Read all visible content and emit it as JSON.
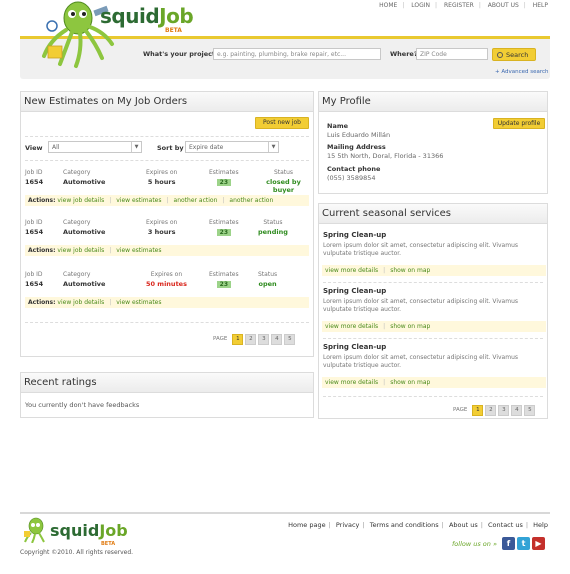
{
  "topnav": [
    "HOME",
    "LOGIN",
    "REGISTER",
    "ABOUT US",
    "HELP"
  ],
  "brand": {
    "part1": "squid",
    "part2": "Job",
    "beta": "BETA"
  },
  "search": {
    "project_label": "What's your project?",
    "project_placeholder": "e.g. painting, plumbing, brake repair, etc...",
    "where_label": "Where?",
    "zip_placeholder": "ZIP Code",
    "button_label": "Search",
    "advanced_label": "+ Advanced search"
  },
  "estimates": {
    "title": "New Estimates on My Job Orders",
    "post_button": "Post new job",
    "view_label": "View",
    "view_value": "All",
    "sort_label": "Sort by",
    "sort_value": "Expire date",
    "col_headers": [
      "Job ID",
      "Category",
      "Expires on",
      "Estimates",
      "Status"
    ],
    "actions_label": "Actions:",
    "jobs": [
      {
        "id": "1654",
        "category": "Automotive",
        "expires": "5 hours",
        "estimates": "23",
        "status": "closed by buyer",
        "status_color": "#2e8b1e",
        "expire_color": "#333333",
        "actions": [
          "view job details",
          "view estimates",
          "another action",
          "another action"
        ]
      },
      {
        "id": "1654",
        "category": "Automotive",
        "expires": "3 hours",
        "estimates": "23",
        "status": "pending",
        "status_color": "#2e8b1e",
        "expire_color": "#333333",
        "actions": [
          "view job details",
          "view estimates"
        ]
      },
      {
        "id": "1654",
        "category": "Automotive",
        "expires": "50 minutes",
        "estimates": "23",
        "status": "open",
        "status_color": "#2e8b1e",
        "expire_color": "#d9261c",
        "actions": [
          "view job details",
          "view estimates"
        ]
      }
    ],
    "pager": {
      "label": "PAGE",
      "pages": [
        "1",
        "2",
        "3",
        "4",
        "5"
      ],
      "current": "1"
    }
  },
  "ratings": {
    "title": "Recent ratings",
    "message": "You currently don't have feedbacks"
  },
  "profile": {
    "title": "My Profile",
    "update_button": "Update profile",
    "name_label": "Name",
    "name_value": "Luis Eduardo Millán",
    "address_label": "Mailing Address",
    "address_value": "15 5th North, Doral, Florida - 31366",
    "phone_label": "Contact phone",
    "phone_value": "(055) 3589854"
  },
  "seasonal": {
    "title": "Current seasonal services",
    "services": [
      {
        "title": "Spring Clean-up",
        "desc": "Lorem ipsum dolor sit amet, consectetur adipiscing elit. Vivamus vulputate tristique auctor.",
        "link1": "view more details",
        "link2": "show on map"
      },
      {
        "title": "Spring Clean-up",
        "desc": "Lorem ipsum dolor sit amet, consectetur adipiscing elit. Vivamus vulputate tristique auctor.",
        "link1": "view more details",
        "link2": "show on map"
      },
      {
        "title": "Spring Clean-up",
        "desc": "Lorem ipsum dolor sit amet, consectetur adipiscing elit. Vivamus vulputate tristique auctor.",
        "link1": "view more details",
        "link2": "show on map"
      }
    ],
    "pager": {
      "label": "PAGE",
      "pages": [
        "1",
        "2",
        "3",
        "4",
        "5"
      ],
      "current": "1"
    }
  },
  "footer": {
    "nav": [
      "Home page",
      "Privacy",
      "Terms and conditions",
      "About us",
      "Contact us",
      "Help"
    ],
    "copyright": "Copyright ©2010. All rights reserved.",
    "follow": "follow us on »",
    "social": [
      {
        "icon": "facebook-icon",
        "glyph": "f",
        "color": "#3b5998"
      },
      {
        "icon": "twitter-icon",
        "glyph": "t",
        "color": "#33a3d6"
      },
      {
        "icon": "youtube-icon",
        "glyph": "▶",
        "color": "#c4302b"
      }
    ]
  }
}
